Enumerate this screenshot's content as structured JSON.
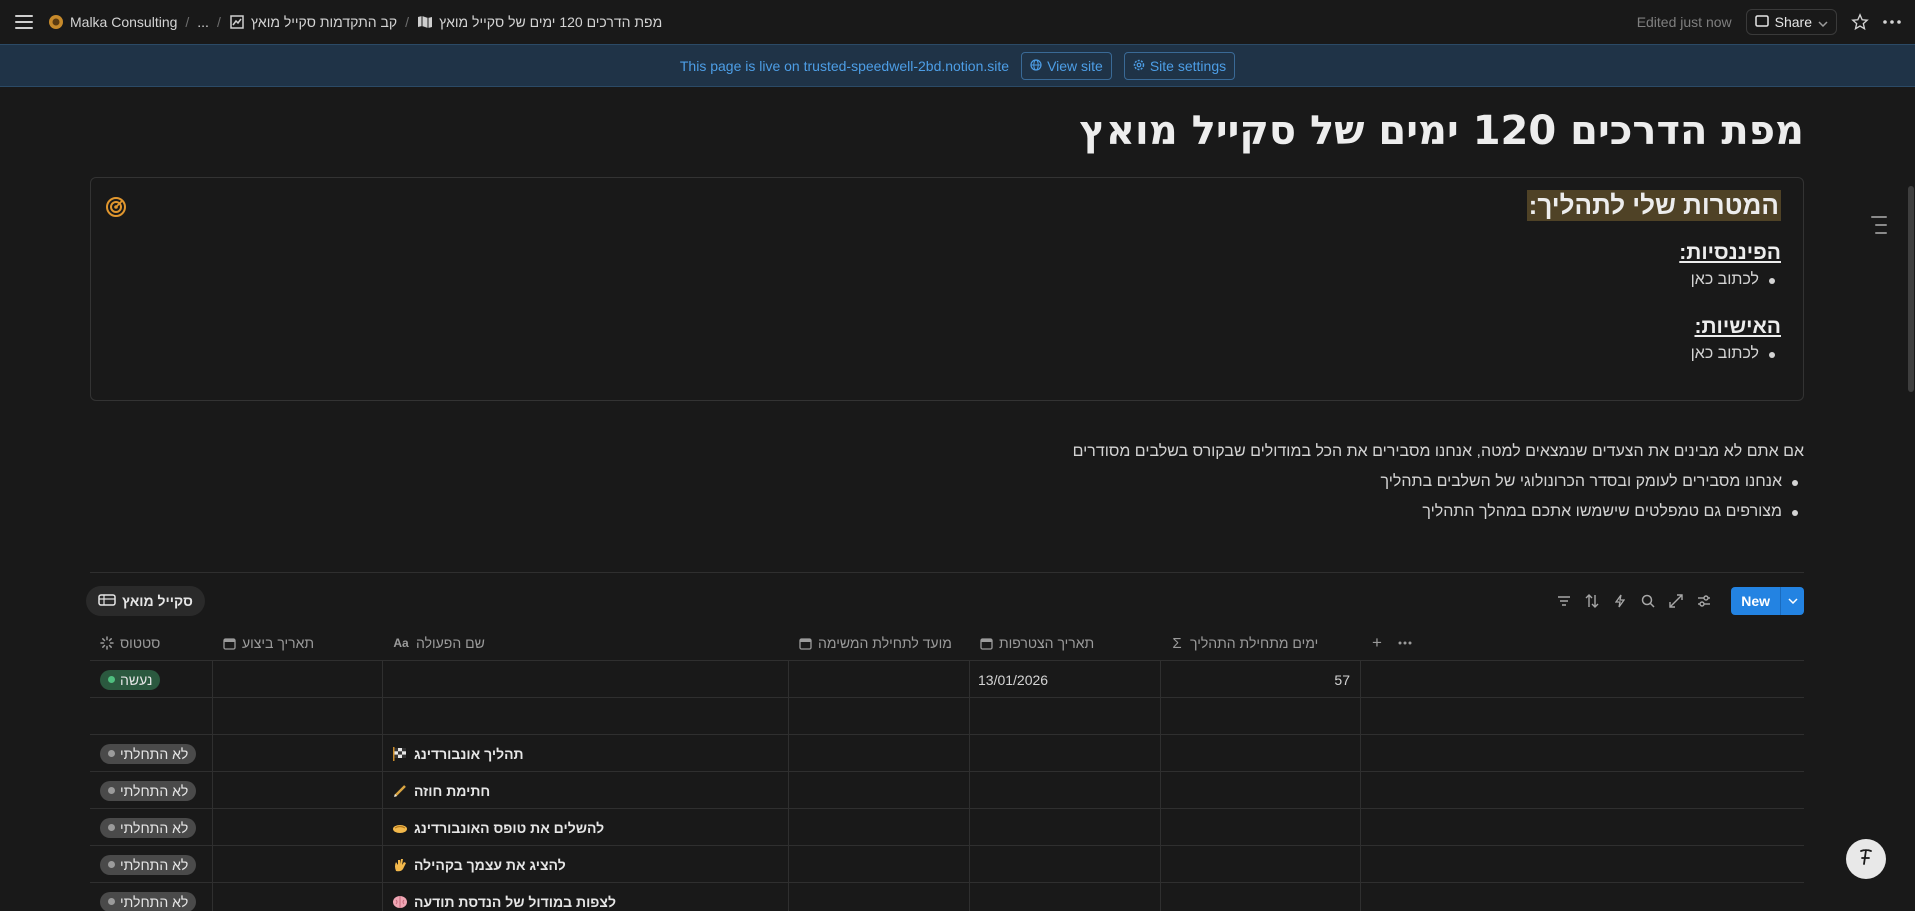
{
  "topbar": {
    "workspace": "Malka Consulting",
    "ellipsis": "...",
    "crumb_tracker": "קב התקדמות סקייל מואץ",
    "crumb_page": "מפת הדרכים 120 ימים של סקייל מואץ",
    "edited": "Edited just now",
    "share_label": "Share"
  },
  "banner": {
    "text": "This page is live on trusted-speedwell-2bd.notion.site",
    "view_site": "View site",
    "site_settings": "Site settings"
  },
  "page": {
    "title": "מפת הדרכים 120 ימים של סקייל מואץ",
    "callout": {
      "heading": "המטרות שלי לתהליך:",
      "financial_heading": "הפיננסיות:",
      "financial_item": "לכתוב כאן",
      "personal_heading": "האישיות:",
      "personal_item": "לכתוב כאן"
    },
    "intro": {
      "line": "אם אתם לא מבינים את הצעדים שנמצאים למטה, אנחנו מסבירים את הכל במודולים שבקורס בשלבים מסודרים",
      "bullets": [
        "אנחנו מסבירים לעומק ובסדר הכרונולוגי של השלבים בתהליך",
        "מצורפים גם טמפלטים שישמשו אתכם במהלך התהליך"
      ]
    }
  },
  "database": {
    "view_name": "סקייל מואץ",
    "new_label": "New",
    "columns": {
      "status": "סטטוס",
      "due": "תאריך ביצוע",
      "name": "שם הפעולה",
      "start_deadline": "מועד לתחילת המשימה",
      "join_date": "תאריך הצטרפות",
      "days": "ימים מתחילת התהליך"
    },
    "rows": [
      {
        "status": "נעשה",
        "status_kind": "done",
        "name": "",
        "join_date": "13/01/2026",
        "days": "57"
      },
      {
        "status": "",
        "status_kind": "none",
        "name": "",
        "join_date": "",
        "days": ""
      },
      {
        "status": "לא התחלתי",
        "status_kind": "todo",
        "name": "תהליך אונבורדינג",
        "emoji": "checkered-flag-icon",
        "join_date": "",
        "days": ""
      },
      {
        "status": "לא התחלתי",
        "status_kind": "todo",
        "name": "חתימת חוזה",
        "emoji": "pen-icon",
        "join_date": "",
        "days": ""
      },
      {
        "status": "לא התחלתי",
        "status_kind": "todo",
        "name": "להשלים את טופס האונבורדינג",
        "emoji": "handshake-icon",
        "join_date": "",
        "days": ""
      },
      {
        "status": "לא התחלתי",
        "status_kind": "todo",
        "name": "להציג את עצמך בקהילה",
        "emoji": "waving-hand-icon",
        "join_date": "",
        "days": ""
      },
      {
        "status": "לא התחלתי",
        "status_kind": "todo",
        "name": "לצפות במודול של הנדסת תודעה",
        "emoji": "brain-icon",
        "join_date": "",
        "days": ""
      }
    ]
  },
  "colors": {
    "background": "#191919",
    "accent": "#2383e2",
    "banner_bg": "#1f3347",
    "done": "#2b593f",
    "todo": "#4a4a4a",
    "highlight": "#4f4226"
  }
}
